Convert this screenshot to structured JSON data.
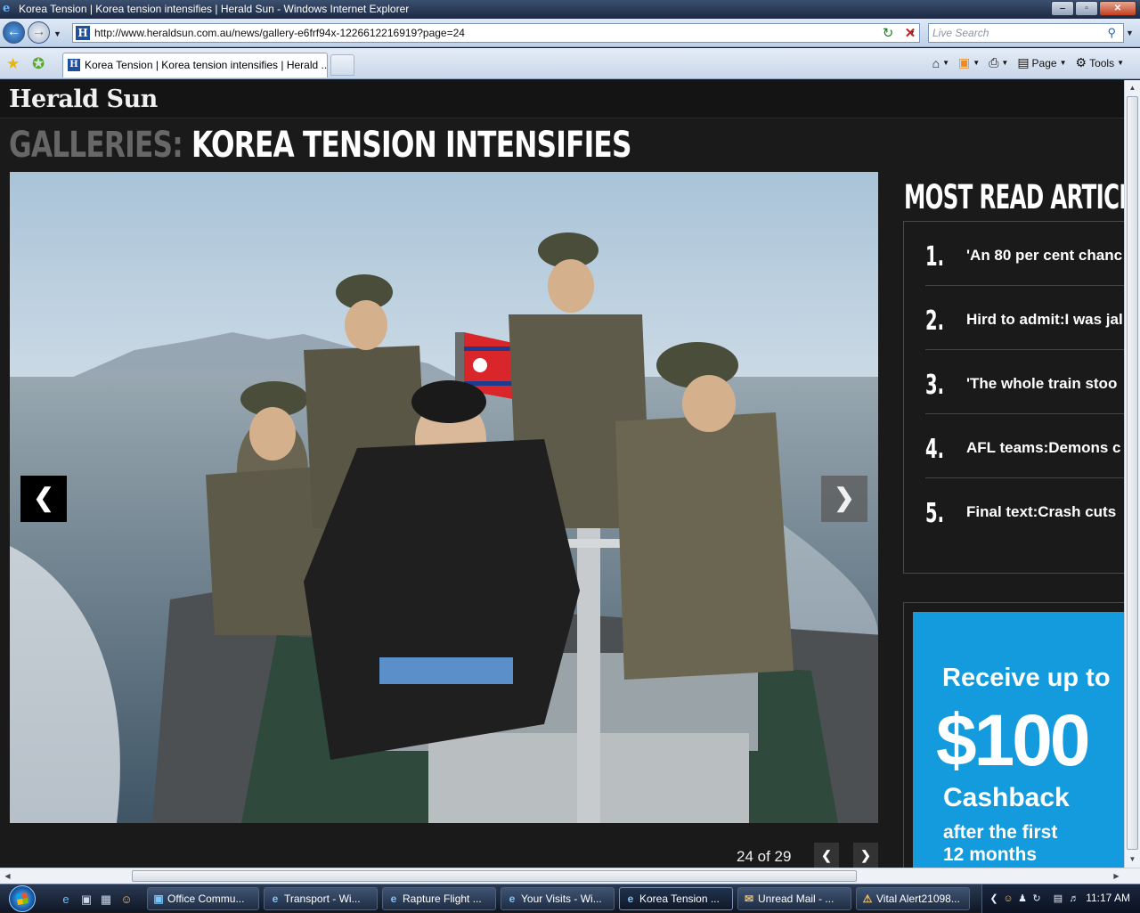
{
  "window": {
    "title": "Korea Tension | Korea tension intensifies | Herald Sun - Windows Internet Explorer",
    "minimize": "‒",
    "maximize": "▫",
    "close": "✕"
  },
  "address_bar": {
    "url": "http://www.heraldsun.com.au/news/gallery-e6frf94x-1226612216919?page=24",
    "search_placeholder": "Live Search"
  },
  "tabs": [
    {
      "label": "Korea Tension | Korea tension intensifies | Herald ..."
    }
  ],
  "command_bar": {
    "page_label": "Page",
    "tools_label": "Tools"
  },
  "site": {
    "logo": "Herald Sun",
    "gallery_prefix": "GALLERIES:",
    "gallery_title": "KOREA TENSION INTENSIFIES",
    "photo_counter": "24 of 29"
  },
  "most_read": {
    "title": "MOST READ ARTICLES",
    "items": [
      {
        "num": "1.",
        "text": "'An 80 per cent chanc"
      },
      {
        "num": "2.",
        "text": "Hird to admit:I was jal"
      },
      {
        "num": "3.",
        "text": "'The whole train stoo"
      },
      {
        "num": "4.",
        "text": "AFL teams:Demons c"
      },
      {
        "num": "5.",
        "text": "Final text:Crash cuts"
      }
    ]
  },
  "ad": {
    "line1": "Receive up to",
    "line2": "$100",
    "line3": "Cashback",
    "line4": "after the first",
    "line5": "12 months",
    "color": "#139bdd"
  },
  "taskbar": {
    "tasks": [
      {
        "label": "Office Commu..."
      },
      {
        "label": "Transport - Wi..."
      },
      {
        "label": "Rapture Flight ..."
      },
      {
        "label": "Your Visits - Wi..."
      },
      {
        "label": "Korea Tension ..."
      },
      {
        "label": "Unread Mail - ..."
      },
      {
        "label": "Vital Alert21098..."
      }
    ],
    "clock": "11:17 AM"
  }
}
